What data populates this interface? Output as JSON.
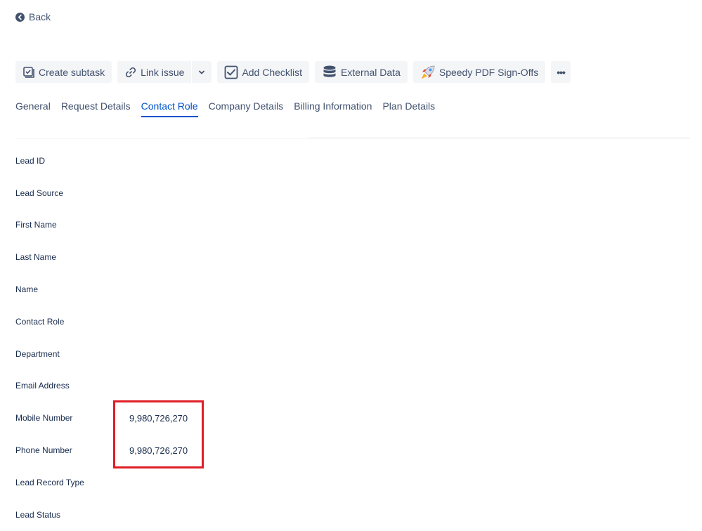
{
  "back": {
    "label": "Back"
  },
  "toolbar": {
    "create_subtask": "Create subtask",
    "link_issue": "Link issue",
    "add_checklist": "Add Checklist",
    "external_data": "External Data",
    "speedy_pdf": "Speedy PDF Sign-Offs",
    "more": "•••"
  },
  "tabs": [
    {
      "label": "General"
    },
    {
      "label": "Request Details"
    },
    {
      "label": "Contact Role"
    },
    {
      "label": "Company Details"
    },
    {
      "label": "Billing Information"
    },
    {
      "label": "Plan Details"
    }
  ],
  "fields": [
    {
      "label": "Lead ID",
      "value": ""
    },
    {
      "label": "Lead Source",
      "value": ""
    },
    {
      "label": "First Name",
      "value": ""
    },
    {
      "label": "Last Name",
      "value": ""
    },
    {
      "label": "Name",
      "value": ""
    },
    {
      "label": "Contact Role",
      "value": ""
    },
    {
      "label": "Department",
      "value": ""
    },
    {
      "label": "Email Address",
      "value": ""
    },
    {
      "label": "Mobile Number",
      "value": "9,980,726,270"
    },
    {
      "label": "Phone Number",
      "value": "9,980,726,270"
    },
    {
      "label": "Lead Record Type",
      "value": ""
    },
    {
      "label": "Lead Status",
      "value": ""
    }
  ],
  "colors": {
    "accent": "#0052cc",
    "highlight": "#e01e26"
  },
  "icons": [
    "arrow-left-circle-icon",
    "subtask-icon",
    "link-icon",
    "chevron-down-icon",
    "checkbox-icon",
    "database-icon",
    "rocket-icon",
    "more-icon"
  ]
}
